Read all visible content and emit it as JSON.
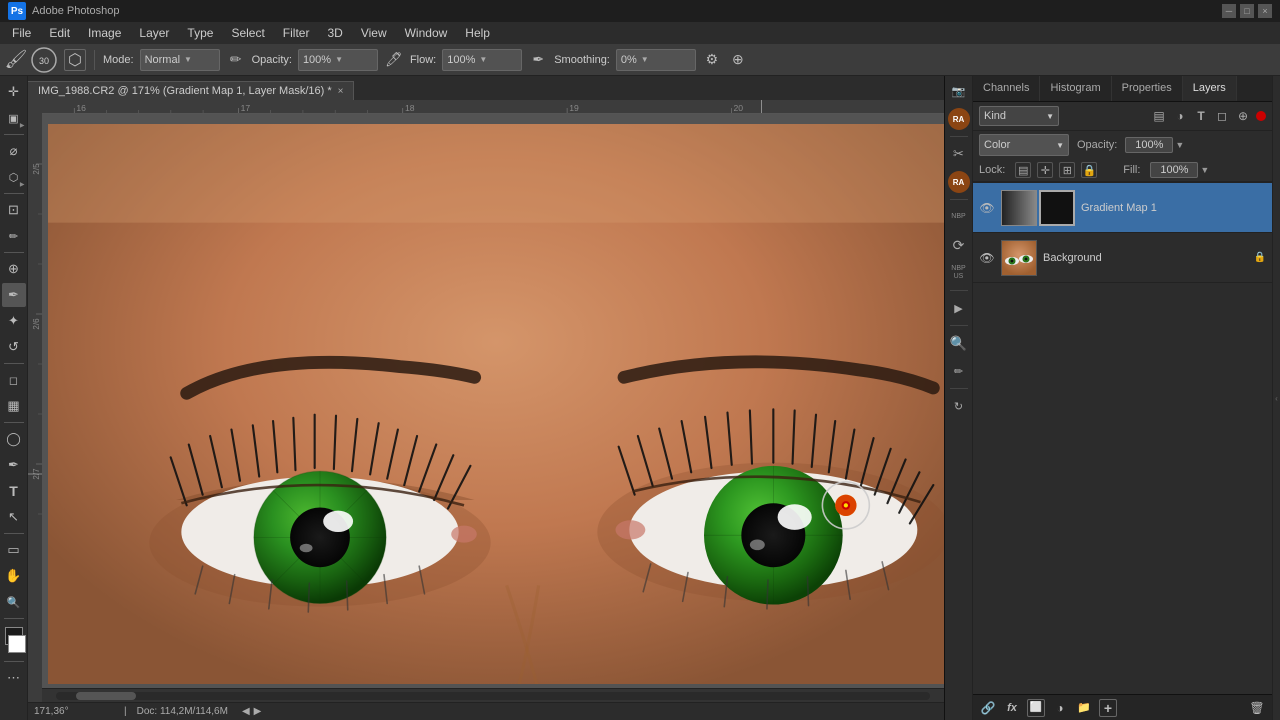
{
  "titlebar": {
    "app": "Ps",
    "title": "Adobe Photoshop"
  },
  "menubar": {
    "items": [
      "File",
      "Edit",
      "Image",
      "Layer",
      "Type",
      "Select",
      "Filter",
      "3D",
      "View",
      "Window",
      "Help"
    ]
  },
  "optionsbar": {
    "brush_size": "30",
    "mode_label": "Mode:",
    "mode_value": "Normal",
    "opacity_label": "Opacity:",
    "opacity_value": "100%",
    "flow_label": "Flow:",
    "flow_value": "100%",
    "smoothing_label": "Smoothing:",
    "smoothing_value": "0%"
  },
  "document": {
    "title": "IMG_1988.CR2 @ 171% (Gradient Map 1, Layer Mask/16) *",
    "close_btn": "×"
  },
  "ruler": {
    "h_marks": [
      "16",
      "17",
      "18",
      "19",
      "20"
    ],
    "v_marks": [
      "2/5",
      "2/6",
      "2/7"
    ]
  },
  "status": {
    "coords": "171,36°",
    "doc_size": "Doc: 114,2M/114,6M"
  },
  "panels": {
    "tabs": [
      "Channels",
      "Histogram",
      "Properties",
      "Layers"
    ],
    "active_tab": "Layers"
  },
  "layers_panel": {
    "kind_label": "Kind",
    "kind_value": "Kind",
    "opacity_label": "Opacity:",
    "opacity_value": "100%",
    "fill_label": "Fill:",
    "fill_value": "100%",
    "lock_label": "Lock:",
    "color_label": "Color",
    "layers": [
      {
        "name": "Gradient Map 1",
        "type": "adjustment",
        "visible": true,
        "thumb1": "black",
        "thumb2": "white"
      },
      {
        "name": "Background",
        "type": "image",
        "visible": true,
        "locked": true,
        "thumb1": "photo"
      }
    ]
  },
  "sidebar": {
    "tools": [
      {
        "name": "move",
        "icon": "✛",
        "label": "Move Tool"
      },
      {
        "name": "artboard",
        "icon": "▣",
        "label": "Artboard"
      },
      {
        "name": "lasso",
        "icon": "⌀",
        "label": "Lasso"
      },
      {
        "name": "quick-select",
        "icon": "⬡",
        "label": "Quick Select"
      },
      {
        "name": "crop",
        "icon": "⊡",
        "label": "Crop"
      },
      {
        "name": "eyedropper",
        "icon": "✏",
        "label": "Eyedropper"
      },
      {
        "name": "healing-brush",
        "icon": "⊕",
        "label": "Healing Brush"
      },
      {
        "name": "brush",
        "icon": "✒",
        "label": "Brush",
        "active": true
      },
      {
        "name": "clone-stamp",
        "icon": "✦",
        "label": "Clone Stamp"
      },
      {
        "name": "history-brush",
        "icon": "↺",
        "label": "History Brush"
      },
      {
        "name": "eraser",
        "icon": "◻",
        "label": "Eraser"
      },
      {
        "name": "gradient",
        "icon": "▦",
        "label": "Gradient"
      },
      {
        "name": "dodge",
        "icon": "◯",
        "label": "Dodge"
      },
      {
        "name": "pen",
        "icon": "✏",
        "label": "Pen"
      },
      {
        "name": "type",
        "icon": "T",
        "label": "Type"
      },
      {
        "name": "path-select",
        "icon": "↖",
        "label": "Path Select"
      },
      {
        "name": "rectangle",
        "icon": "▭",
        "label": "Rectangle"
      },
      {
        "name": "hand",
        "icon": "✋",
        "label": "Hand"
      },
      {
        "name": "zoom",
        "icon": "🔍",
        "label": "Zoom"
      },
      {
        "name": "more",
        "icon": "⋯",
        "label": "More"
      }
    ]
  },
  "vert_sidebar": {
    "items": [
      {
        "name": "camera-icon",
        "icon": "📷"
      },
      {
        "name": "ra-avatar-top",
        "label": "RA"
      },
      {
        "name": "scissors-icon",
        "icon": "✂"
      },
      {
        "name": "ra-avatar-bottom",
        "label": "RA"
      },
      {
        "name": "nbp-icon",
        "label": "NBP"
      },
      {
        "name": "zigzag-icon",
        "icon": "⟳"
      },
      {
        "name": "nbp-us-icon",
        "label": "NBP\nUS"
      },
      {
        "name": "play-icon",
        "icon": "▶"
      },
      {
        "name": "search-icon",
        "icon": "🔍"
      },
      {
        "name": "edit-icon",
        "icon": "✏"
      },
      {
        "name": "loop-icon",
        "icon": "↻"
      }
    ]
  },
  "layer_bottom_buttons": [
    {
      "name": "link-layers",
      "icon": "🔗"
    },
    {
      "name": "add-fx",
      "icon": "fx"
    },
    {
      "name": "add-mask",
      "icon": "⬜"
    },
    {
      "name": "new-fill",
      "icon": "◑"
    },
    {
      "name": "new-group",
      "icon": "📁"
    },
    {
      "name": "new-layer",
      "icon": "+"
    },
    {
      "name": "delete-layer",
      "icon": "🗑"
    }
  ]
}
